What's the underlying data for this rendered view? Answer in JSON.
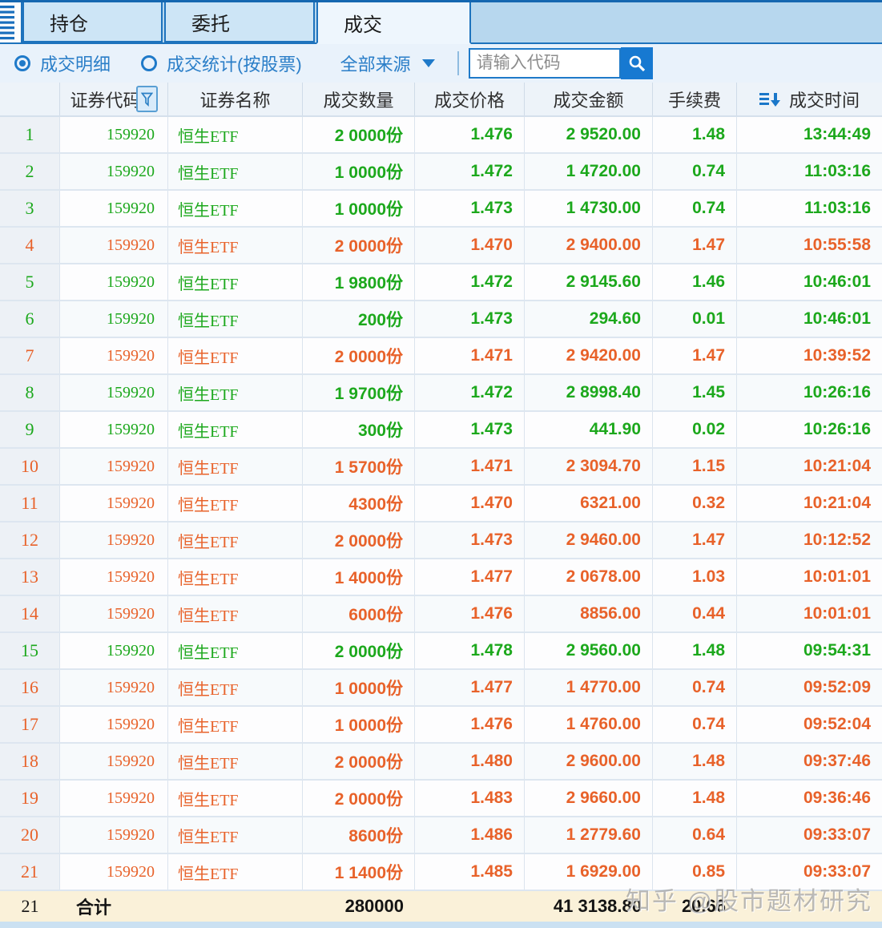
{
  "tabs": [
    {
      "label": "持仓",
      "active": false
    },
    {
      "label": "委托",
      "active": false
    },
    {
      "label": "成交",
      "active": true
    }
  ],
  "toolbar": {
    "radios": [
      {
        "label": "成交明细",
        "selected": true
      },
      {
        "label": "成交统计(按股票)",
        "selected": false
      }
    ],
    "source_dropdown": {
      "value": "全部来源"
    },
    "search": {
      "placeholder": "请输入代码"
    }
  },
  "table": {
    "columns": {
      "code": "证券代码",
      "name": "证券名称",
      "quantity": "成交数量",
      "price": "成交价格",
      "amount": "成交金额",
      "fee": "手续费",
      "time": "成交时间"
    },
    "rows": [
      {
        "index": "1",
        "code": "159920",
        "name": "恒生ETF",
        "quantity": "2 0000份",
        "price": "1.476",
        "amount": "2 9520.00",
        "fee": "1.48",
        "time": "13:44:49",
        "color": "green"
      },
      {
        "index": "2",
        "code": "159920",
        "name": "恒生ETF",
        "quantity": "1 0000份",
        "price": "1.472",
        "amount": "1 4720.00",
        "fee": "0.74",
        "time": "11:03:16",
        "color": "green"
      },
      {
        "index": "3",
        "code": "159920",
        "name": "恒生ETF",
        "quantity": "1 0000份",
        "price": "1.473",
        "amount": "1 4730.00",
        "fee": "0.74",
        "time": "11:03:16",
        "color": "green"
      },
      {
        "index": "4",
        "code": "159920",
        "name": "恒生ETF",
        "quantity": "2 0000份",
        "price": "1.470",
        "amount": "2 9400.00",
        "fee": "1.47",
        "time": "10:55:58",
        "color": "orange"
      },
      {
        "index": "5",
        "code": "159920",
        "name": "恒生ETF",
        "quantity": "1 9800份",
        "price": "1.472",
        "amount": "2 9145.60",
        "fee": "1.46",
        "time": "10:46:01",
        "color": "green"
      },
      {
        "index": "6",
        "code": "159920",
        "name": "恒生ETF",
        "quantity": "200份",
        "price": "1.473",
        "amount": "294.60",
        "fee": "0.01",
        "time": "10:46:01",
        "color": "green"
      },
      {
        "index": "7",
        "code": "159920",
        "name": "恒生ETF",
        "quantity": "2 0000份",
        "price": "1.471",
        "amount": "2 9420.00",
        "fee": "1.47",
        "time": "10:39:52",
        "color": "orange"
      },
      {
        "index": "8",
        "code": "159920",
        "name": "恒生ETF",
        "quantity": "1 9700份",
        "price": "1.472",
        "amount": "2 8998.40",
        "fee": "1.45",
        "time": "10:26:16",
        "color": "green"
      },
      {
        "index": "9",
        "code": "159920",
        "name": "恒生ETF",
        "quantity": "300份",
        "price": "1.473",
        "amount": "441.90",
        "fee": "0.02",
        "time": "10:26:16",
        "color": "green"
      },
      {
        "index": "10",
        "code": "159920",
        "name": "恒生ETF",
        "quantity": "1 5700份",
        "price": "1.471",
        "amount": "2 3094.70",
        "fee": "1.15",
        "time": "10:21:04",
        "color": "orange"
      },
      {
        "index": "11",
        "code": "159920",
        "name": "恒生ETF",
        "quantity": "4300份",
        "price": "1.470",
        "amount": "6321.00",
        "fee": "0.32",
        "time": "10:21:04",
        "color": "orange"
      },
      {
        "index": "12",
        "code": "159920",
        "name": "恒生ETF",
        "quantity": "2 0000份",
        "price": "1.473",
        "amount": "2 9460.00",
        "fee": "1.47",
        "time": "10:12:52",
        "color": "orange"
      },
      {
        "index": "13",
        "code": "159920",
        "name": "恒生ETF",
        "quantity": "1 4000份",
        "price": "1.477",
        "amount": "2 0678.00",
        "fee": "1.03",
        "time": "10:01:01",
        "color": "orange"
      },
      {
        "index": "14",
        "code": "159920",
        "name": "恒生ETF",
        "quantity": "6000份",
        "price": "1.476",
        "amount": "8856.00",
        "fee": "0.44",
        "time": "10:01:01",
        "color": "orange"
      },
      {
        "index": "15",
        "code": "159920",
        "name": "恒生ETF",
        "quantity": "2 0000份",
        "price": "1.478",
        "amount": "2 9560.00",
        "fee": "1.48",
        "time": "09:54:31",
        "color": "green"
      },
      {
        "index": "16",
        "code": "159920",
        "name": "恒生ETF",
        "quantity": "1 0000份",
        "price": "1.477",
        "amount": "1 4770.00",
        "fee": "0.74",
        "time": "09:52:09",
        "color": "orange"
      },
      {
        "index": "17",
        "code": "159920",
        "name": "恒生ETF",
        "quantity": "1 0000份",
        "price": "1.476",
        "amount": "1 4760.00",
        "fee": "0.74",
        "time": "09:52:04",
        "color": "orange"
      },
      {
        "index": "18",
        "code": "159920",
        "name": "恒生ETF",
        "quantity": "2 0000份",
        "price": "1.480",
        "amount": "2 9600.00",
        "fee": "1.48",
        "time": "09:37:46",
        "color": "orange"
      },
      {
        "index": "19",
        "code": "159920",
        "name": "恒生ETF",
        "quantity": "2 0000份",
        "price": "1.483",
        "amount": "2 9660.00",
        "fee": "1.48",
        "time": "09:36:46",
        "color": "orange"
      },
      {
        "index": "20",
        "code": "159920",
        "name": "恒生ETF",
        "quantity": "8600份",
        "price": "1.486",
        "amount": "1 2779.60",
        "fee": "0.64",
        "time": "09:33:07",
        "color": "orange"
      },
      {
        "index": "21",
        "code": "159920",
        "name": "恒生ETF",
        "quantity": "1 1400份",
        "price": "1.485",
        "amount": "1 6929.00",
        "fee": "0.85",
        "time": "09:33:07",
        "color": "orange"
      }
    ],
    "footer": {
      "index": "21",
      "label": "合计",
      "quantity": "280000",
      "amount": "41 3138.80",
      "fee": "20.66"
    }
  },
  "watermark": "知乎 @股市题材研究",
  "colors": {
    "buy_green": "#1ca81c",
    "sell_orange": "#e8622a",
    "accent_blue": "#1f7ac9"
  }
}
